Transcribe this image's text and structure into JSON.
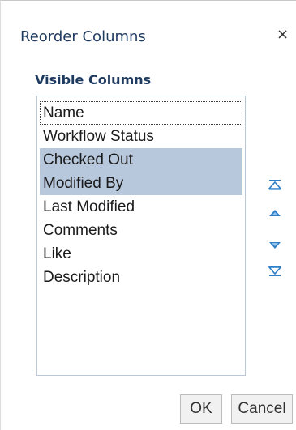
{
  "dialog": {
    "title": "Reorder Columns",
    "close_symbol": "×"
  },
  "visible_columns": {
    "label": "Visible Columns",
    "items": [
      {
        "label": "Name",
        "selected": false,
        "focused": true
      },
      {
        "label": "Workflow Status",
        "selected": false,
        "focused": false
      },
      {
        "label": "Checked Out",
        "selected": true,
        "focused": false
      },
      {
        "label": "Modified By",
        "selected": true,
        "focused": false
      },
      {
        "label": "Last Modified",
        "selected": false,
        "focused": false
      },
      {
        "label": "Comments",
        "selected": false,
        "focused": false
      },
      {
        "label": "Like",
        "selected": false,
        "focused": false
      },
      {
        "label": "Description",
        "selected": false,
        "focused": false
      }
    ]
  },
  "move_controls": {
    "icons": [
      "move-to-top-icon",
      "move-up-icon",
      "move-down-icon",
      "move-to-bottom-icon"
    ],
    "color": "#2f7fc8"
  },
  "buttons": {
    "ok_label": "OK",
    "cancel_label": "Cancel"
  },
  "colors": {
    "title": "#1f3a5f",
    "selection": "#b7c7dc"
  }
}
